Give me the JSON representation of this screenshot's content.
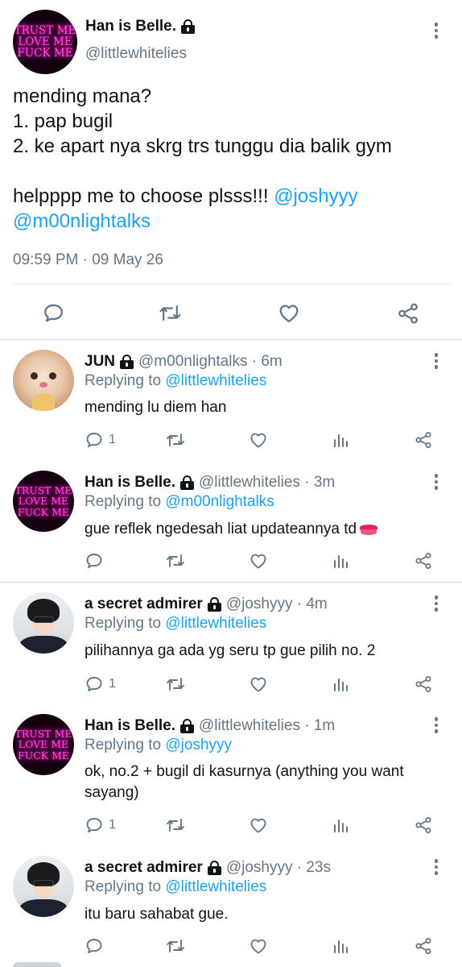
{
  "main_tweet": {
    "avatar_text": [
      "TRUST ME",
      "LOVE ME",
      "FUCK ME"
    ],
    "display_name": "Han is Belle.",
    "handle": "@littlewhitelies",
    "text_lines": [
      "mending mana?",
      "1. pap bugil",
      "2. ke apart nya skrg trs tunggu dia balik gym",
      "",
      "helpppp me to choose plsss!!! "
    ],
    "mention_1": "@joshyyy",
    "mention_2": "@m00nlightalks",
    "timestamp": "09:59 PM · 09 May 26",
    "actions": [
      "reply-icon",
      "retweet-icon",
      "like-icon",
      "share-icon"
    ]
  },
  "replies": [
    {
      "avatar": "cat-photo",
      "display_name": "JUN",
      "handle_time": "@m00nlightalks · 6m",
      "replying_prefix": "Replying to ",
      "replying_to": "@littlewhitelies",
      "text": "mending lu diem han",
      "reply_count": "1"
    },
    {
      "avatar": "neon-sign",
      "avatar_text": [
        "TRUST ME",
        "LOVE ME",
        "FUCK ME"
      ],
      "display_name": "Han is Belle.",
      "handle_time": "@littlewhitelies · 3m",
      "replying_prefix": "Replying to ",
      "replying_to": "@m00nlightalks",
      "text": "gue reflek ngedesah liat updateannya td",
      "emoji": "lips-emoji",
      "reply_count": ""
    },
    {
      "avatar": "person-photo",
      "display_name": "a secret admirer",
      "handle_time": "@joshyyy · 4m",
      "replying_prefix": "Replying to ",
      "replying_to": "@littlewhitelies",
      "text": "pilihannya ga ada yg seru tp gue pilih no. 2",
      "reply_count": "1"
    },
    {
      "avatar": "neon-sign",
      "avatar_text": [
        "TRUST ME",
        "LOVE ME",
        "FUCK ME"
      ],
      "display_name": "Han is Belle.",
      "handle_time": "@littlewhitelies · 1m",
      "replying_prefix": "Replying to ",
      "replying_to": "@joshyyy",
      "text": "ok, no.2 + bugil di kasurnya (anything you want sayang)",
      "reply_count": "1"
    },
    {
      "avatar": "person-photo",
      "display_name": "a secret admirer",
      "handle_time": "@joshyyy · 23s",
      "replying_prefix": "Replying to ",
      "replying_to": "@littlewhitelies",
      "text": "itu baru sahabat gue.",
      "reply_count": ""
    }
  ],
  "colors": {
    "text": "#0f1419",
    "secondary": "#657786",
    "link": "#1da1f2",
    "divider": "#e1e8ed"
  }
}
